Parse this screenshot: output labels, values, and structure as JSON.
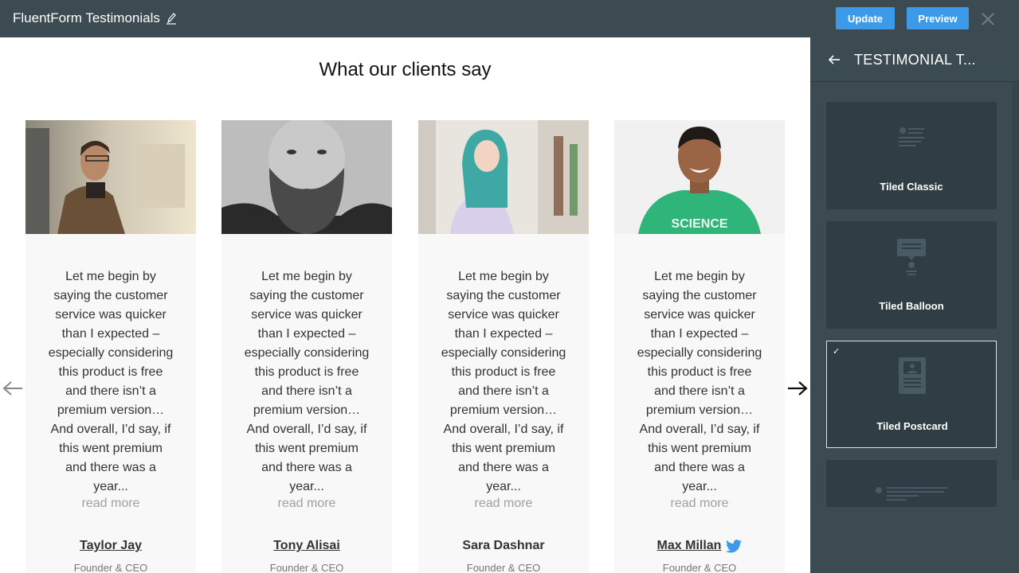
{
  "topbar": {
    "title": "FluentForm Testimonials",
    "update_label": "Update",
    "preview_label": "Preview",
    "accent": "#3d9ae8"
  },
  "canvas": {
    "heading": "What our clients say",
    "testimonials": [
      {
        "quote": "Let me begin by saying the customer service was quicker than I expected – especially considering this product is free and there isn’t a premium version… And overall, I’d say, if this went premium and there was a year...",
        "read_more": "read more",
        "name": "Taylor Jay",
        "role": "Founder & CEO",
        "photo": "man-with-glasses-photo"
      },
      {
        "quote": "Let me begin by saying the customer service was quicker than I expected – especially considering this product is free and there isn’t a premium version… And overall, I’d say, if this went premium and there was a year...",
        "read_more": "read more",
        "name": "Tony Alisai",
        "role": "Founder & CEO",
        "photo": "bearded-man-bw-photo"
      },
      {
        "quote": "Let me begin by saying the customer service was quicker than I expected – especially considering this product is free and there isn’t a premium version… And overall, I’d say, if this went premium and there was a year...",
        "read_more": "read more",
        "name": "Sara Dashnar",
        "role": "Founder & CEO",
        "photo": "woman-teal-hair-photo"
      },
      {
        "quote": "Let me begin by saying the customer service was quicker than I expected – especially considering this product is free and there isn’t a premium version… And overall, I’d say, if this went premium and there was a year...",
        "read_more": "read more",
        "name": "Max Millan",
        "role": "Founder & CEO",
        "photo": "man-green-shirt-photo",
        "social_icon": "twitter-icon"
      }
    ]
  },
  "panel": {
    "title": "TESTIMONIAL T...",
    "templates": [
      {
        "label": "Tiled Classic",
        "icon": "classic-template-icon",
        "selected": false
      },
      {
        "label": "Tiled Balloon",
        "icon": "balloon-template-icon",
        "selected": false
      },
      {
        "label": "Tiled Postcard",
        "icon": "postcard-template-icon",
        "selected": true,
        "check": "✓"
      },
      {
        "label": "",
        "icon": "list-template-icon",
        "selected": false
      }
    ]
  }
}
